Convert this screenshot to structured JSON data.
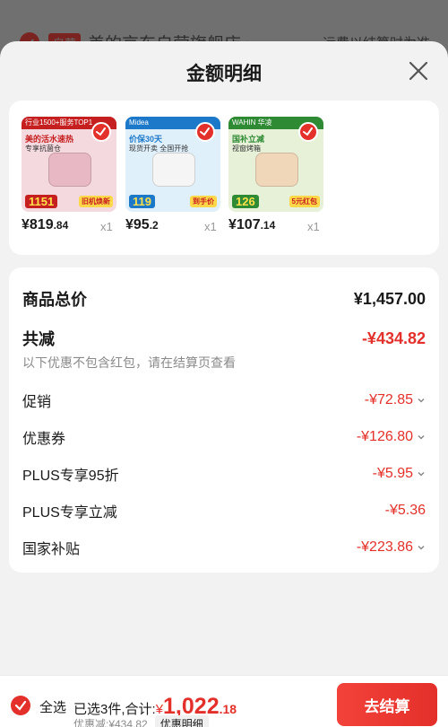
{
  "background": {
    "badge": "自营",
    "store_name": "美的京东自营旗舰店 ›",
    "shipping_note": "运费以结算时为准"
  },
  "sheet": {
    "title": "金额明细"
  },
  "products": [
    {
      "price_int": "¥819",
      "price_dec": ".84",
      "qty": "x1",
      "thumb": {
        "top_label": "行业1500+服务TOP1",
        "headline": "美的活水速热",
        "sub": "专享抗菌仓",
        "promo": "1151",
        "tag": "旧机焕新",
        "colors": {
          "bg": "#f4d9df",
          "band": "#c61f1f",
          "device": "#e9b8c5"
        }
      }
    },
    {
      "price_int": "¥95",
      "price_dec": ".2",
      "qty": "x1",
      "thumb": {
        "top_label": "Midea",
        "headline": "价保30天",
        "sub": "现货开卖 全国开抢",
        "promo": "119",
        "tag": "到手价",
        "colors": {
          "bg": "#dff0fb",
          "band": "#1c78c8",
          "device": "#f5f5f5"
        }
      }
    },
    {
      "price_int": "¥107",
      "price_dec": ".14",
      "qty": "x1",
      "thumb": {
        "top_label": "WAHIN 华凌",
        "headline": "国补立减",
        "sub": "视窗烤箱",
        "promo": "126",
        "tag": "5元红包",
        "colors": {
          "bg": "#e6f1d8",
          "band": "#2f8a34",
          "device": "#f1d7b9"
        }
      }
    }
  ],
  "summary": {
    "total_label": "商品总价",
    "total_value": "¥1,457.00",
    "reduce_label": "共减",
    "reduce_value": "-¥434.82",
    "reduce_note": "以下优惠不包含红包，请在结算页查看",
    "items": [
      {
        "label": "促销",
        "value": "-¥72.85",
        "expandable": true
      },
      {
        "label": "优惠券",
        "value": "-¥126.80",
        "expandable": true
      },
      {
        "label": "PLUS专享95折",
        "value": "-¥5.95",
        "expandable": true
      },
      {
        "label": "PLUS专享立减",
        "value": "-¥5.36",
        "expandable": false
      },
      {
        "label": "国家补贴",
        "value": "-¥223.86",
        "expandable": true
      }
    ]
  },
  "bottom_bar": {
    "all_label": "全选",
    "selected_text": "已选3件,合计:",
    "total_currency": "¥",
    "total_int": "1,022",
    "total_dec": ".18",
    "discount_text": "优惠减:¥434.82",
    "detail_tag": "优惠明细",
    "checkout_label": "去结算"
  },
  "colors": {
    "accent_red": "#e4302a",
    "sheet_bg": "#f2f2f2",
    "overlay_bg": "#6b6b6b"
  }
}
